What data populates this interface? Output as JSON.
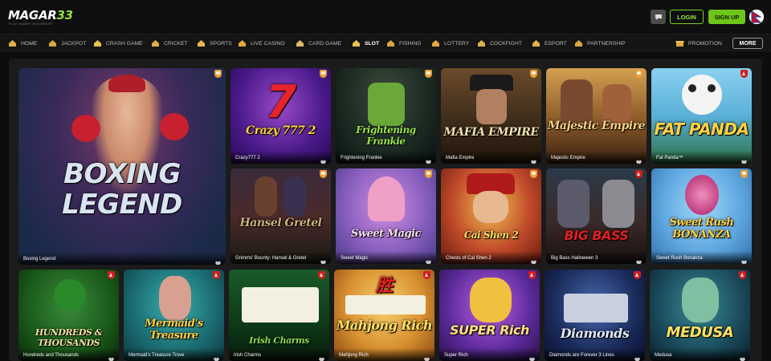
{
  "brand": {
    "logo_main": "MAGAR",
    "logo_num": "33",
    "logo_tag": "PLAY SMART WIN SMART",
    "accent": "#7ed321"
  },
  "header": {
    "chat_icon": "chat-bubble-icon",
    "login_label": "LOGIN",
    "signup_label": "SIGN UP",
    "flag_icon": "nepal-flag-icon"
  },
  "nav": {
    "items": [
      {
        "label": "HOME",
        "icon": "home-icon"
      },
      {
        "label": "JACKPOT",
        "icon": "jackpot-icon"
      },
      {
        "label": "CRASH GAME",
        "icon": "rocket-icon"
      },
      {
        "label": "CRICKET",
        "icon": "cricket-icon"
      },
      {
        "label": "SPORTS",
        "icon": "sports-icon"
      },
      {
        "label": "LIVE CASINO",
        "icon": "live-casino-icon"
      },
      {
        "label": "CARD GAME",
        "icon": "cards-icon"
      },
      {
        "label": "SLOT",
        "icon": "slot-icon",
        "active": true
      },
      {
        "label": "FISHING",
        "icon": "fish-icon"
      },
      {
        "label": "LOTTERY",
        "icon": "lottery-icon"
      },
      {
        "label": "COCKFIGHT",
        "icon": "rooster-icon"
      },
      {
        "label": "ESPORT",
        "icon": "gamepad-icon"
      },
      {
        "label": "PARTNERSHIP",
        "icon": "partnership-icon"
      }
    ],
    "promotion_label": "PROMOTION",
    "promotion_icon": "gift-icon",
    "more_label": "MORE"
  },
  "games": {
    "featured": {
      "name": "Boxing Legend",
      "art_title_1": "BOXING",
      "art_title_2": "LEGEND",
      "badge": "orange"
    },
    "row1": [
      {
        "name": "Crazy777 2",
        "art_title": "Crazy 777 2",
        "badge": "orange"
      },
      {
        "name": "Frightening Frankie",
        "art_title": "Frightening Frankie",
        "badge": "orange"
      },
      {
        "name": "Mafia Empire",
        "art_title": "MAFIA EMPIRE",
        "badge": "orange"
      },
      {
        "name": "Majestic Empire",
        "art_title": "Majestic Empire",
        "badge": "orange"
      },
      {
        "name": "Fat Panda™",
        "art_title": "FAT PANDA",
        "badge": "red"
      }
    ],
    "row2": [
      {
        "name": "Grimms' Bounty: Hansel & Gretel",
        "art_title": "Hansel Gretel",
        "badge": "orange"
      },
      {
        "name": "Sweet Magic",
        "art_title": "Sweet Magic",
        "badge": "orange"
      },
      {
        "name": "Chests of Cai Shen 2",
        "art_title": "Cai Shen 2",
        "badge": "orange"
      },
      {
        "name": "Big Bass Halloween 3",
        "art_title": "BIG BASS",
        "badge": "red"
      },
      {
        "name": "Sweet Rush Bonanza",
        "art_title": "Sweet Rush BONANZA",
        "badge": "orange"
      }
    ],
    "row3": [
      {
        "name": "Hundreds and Thousands",
        "art_title": "HUNDREDS & THOUSANDS",
        "badge": "red"
      },
      {
        "name": "Mermaid's Treasure Trove",
        "art_title": "Mermaid's Treasure",
        "badge": "red"
      },
      {
        "name": "Irish Charms",
        "art_title": "Irish Charms",
        "badge": "red"
      },
      {
        "name": "Mahjong Rich",
        "art_title": "Mahjong Rich",
        "badge": "red"
      },
      {
        "name": "Super Rich",
        "art_title": "SUPER Rich",
        "badge": "red"
      },
      {
        "name": "Diamonds are Forever 3 Lines",
        "art_title": "Diamonds",
        "badge": "red"
      },
      {
        "name": "Medusa",
        "art_title": "MEDUSA",
        "badge": "red"
      }
    ]
  }
}
